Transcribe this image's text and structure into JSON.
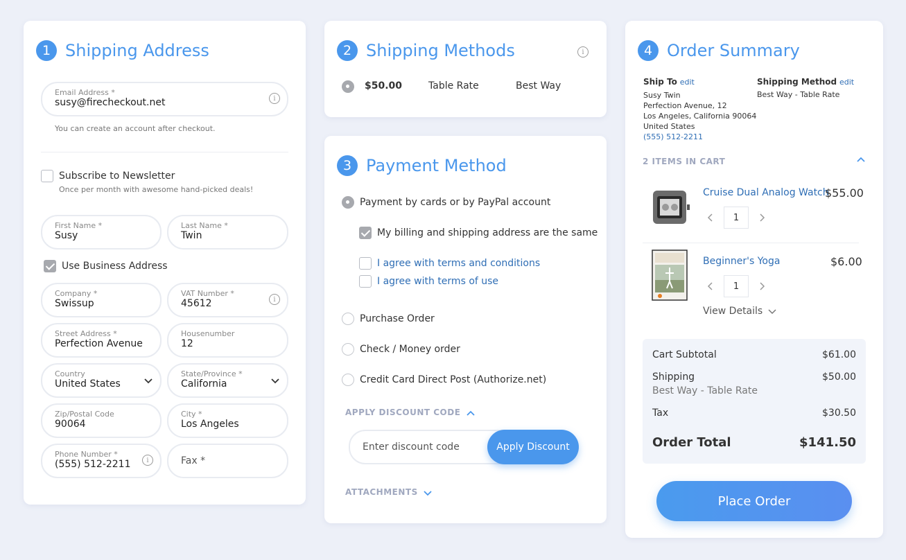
{
  "shipping_address": {
    "step": "1",
    "title": "Shipping Address",
    "email": {
      "label": "Email Address *",
      "value": "susy@firecheckout.net"
    },
    "email_hint": "You can create an account after checkout.",
    "newsletter": {
      "label": "Subscribe to Newsletter",
      "hint": "Once per month with awesome hand-picked deals!"
    },
    "first_name": {
      "label": "First Name *",
      "value": "Susy"
    },
    "last_name": {
      "label": "Last Name *",
      "value": "Twin"
    },
    "business": {
      "label": "Use Business Address"
    },
    "company": {
      "label": "Company *",
      "value": "Swissup"
    },
    "vat": {
      "label": "VAT Number *",
      "value": "45612"
    },
    "street": {
      "label": "Street Address *",
      "value": "Perfection Avenue"
    },
    "housenumber": {
      "label": "Housenumber",
      "value": "12"
    },
    "country": {
      "label": "Country",
      "value": "United States"
    },
    "state": {
      "label": "State/Province *",
      "value": "California"
    },
    "zip": {
      "label": "Zip/Postal Code",
      "value": "90064"
    },
    "city": {
      "label": "City *",
      "value": "Los Angeles"
    },
    "phone": {
      "label": "Phone Number *",
      "value": "(555) 512-2211"
    },
    "fax": {
      "placeholder": "Fax *"
    }
  },
  "shipping_methods": {
    "step": "2",
    "title": "Shipping Methods",
    "rate": {
      "price": "$50.00",
      "name": "Table Rate",
      "carrier": "Best Way"
    }
  },
  "payment_method": {
    "step": "3",
    "title": "Payment Method",
    "options": [
      {
        "label": "Payment by cards or by PayPal account"
      },
      {
        "label": "Purchase Order"
      },
      {
        "label": "Check / Money order"
      },
      {
        "label": "Credit Card Direct Post (Authorize.net)"
      }
    ],
    "same_address": "My billing and shipping address are the same",
    "terms1": "I agree with terms and conditions",
    "terms2": "I agree with terms of use",
    "discount_toggle": "APPLY DISCOUNT CODE",
    "discount_placeholder": "Enter discount code",
    "apply_label": "Apply Discount",
    "attachments_toggle": "ATTACHMENTS"
  },
  "order_summary": {
    "step": "4",
    "title": "Order Summary",
    "ship_to_label": "Ship To",
    "edit": "edit",
    "ship_to_lines": [
      "Susy Twin",
      "Perfection Avenue, 12",
      "Los Angeles, California 90064",
      "United States"
    ],
    "ship_to_phone": "(555) 512-2211",
    "shipping_method_label": "Shipping Method",
    "shipping_method_value": "Best Way - Table Rate",
    "items_header": "2 ITEMS IN CART",
    "items": [
      {
        "name": "Cruise Dual Analog Watch",
        "price": "$55.00",
        "qty": "1"
      },
      {
        "name": "Beginner's Yoga",
        "price": "$6.00",
        "qty": "1"
      }
    ],
    "view_details": "View Details",
    "subtotal_label": "Cart Subtotal",
    "subtotal_value": "$61.00",
    "shipping_label": "Shipping",
    "shipping_value": "$50.00",
    "shipping_sub": "Best Way - Table Rate",
    "tax_label": "Tax",
    "tax_value": "$30.50",
    "total_label": "Order Total",
    "total_value": "$141.50",
    "place_order": "Place Order"
  },
  "colors": {
    "accent": "#4a97ec",
    "link": "#2f6eb5",
    "background": "#edf0f8"
  }
}
